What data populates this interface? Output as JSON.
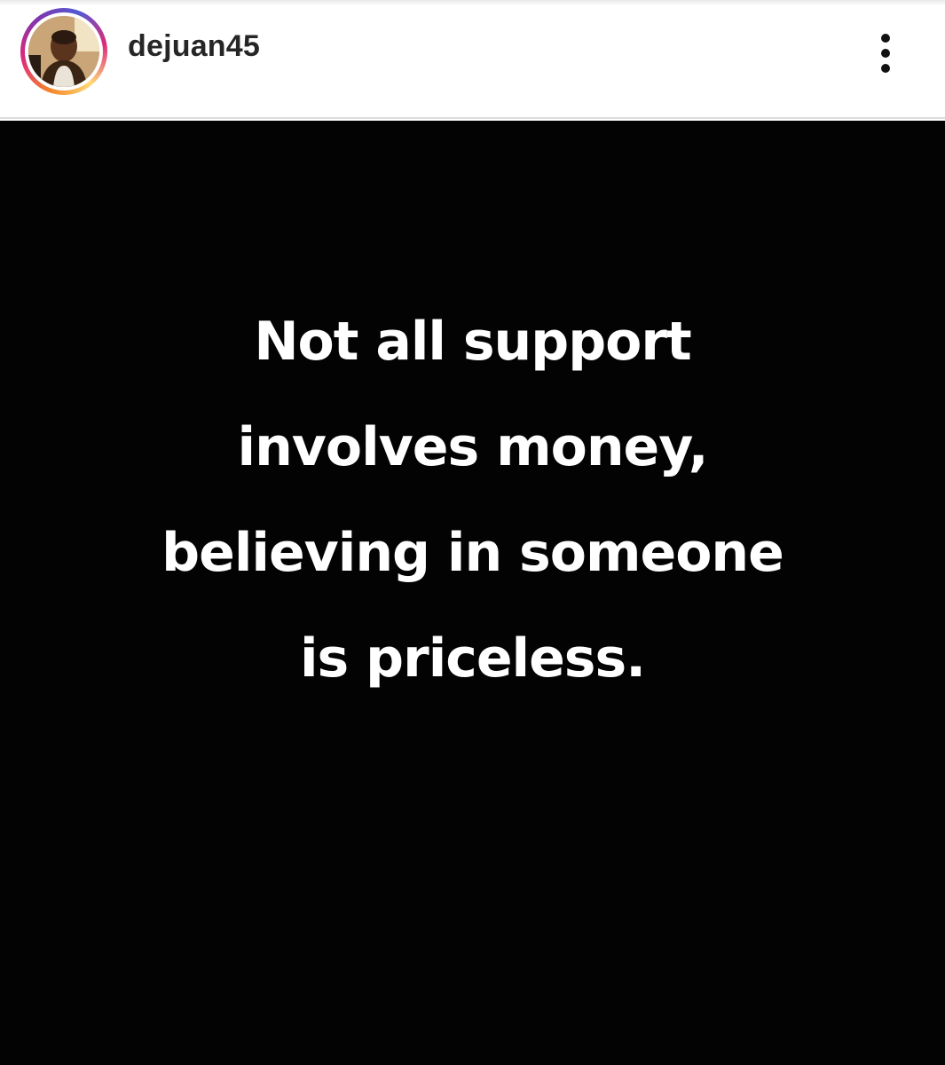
{
  "post": {
    "username": "dejuan45",
    "menu_icon": "more-vertical-icon",
    "avatar_ring_colors": [
      "#f58529",
      "#dd2a7b",
      "#8134af",
      "#515bd4",
      "#feda77"
    ],
    "image": {
      "background_color": "#030303",
      "text_color": "#ffffff",
      "quote_lines": [
        "Not all support",
        "involves money,",
        "believing in someone",
        "is priceless."
      ]
    }
  }
}
